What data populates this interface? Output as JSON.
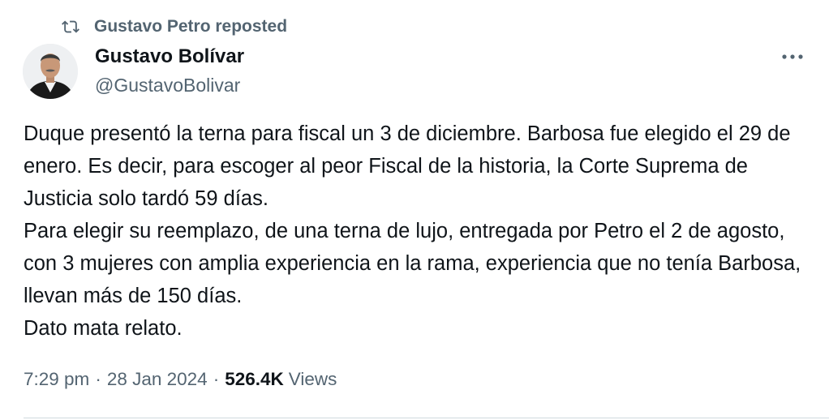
{
  "repost": {
    "label": "Gustavo Petro reposted",
    "icon": "repost-icon"
  },
  "author": {
    "name": "Gustavo Bolívar",
    "handle": "@GustavoBolivar"
  },
  "more": {
    "icon": "more-icon"
  },
  "body": {
    "lines": [
      "Duque presentó la terna para fiscal un 3 de diciembre. Barbosa fue elegido el 29 de enero. Es decir, para escoger al peor Fiscal de la historia, la Corte Suprema de Justicia solo tardó 59 días.",
      "Para elegir su reemplazo, de una terna de lujo, entregada por Petro el 2 de agosto, con 3 mujeres con amplia experiencia en la rama, experiencia que no tenía Barbosa, llevan más de 150 días.",
      "Dato mata relato."
    ]
  },
  "meta": {
    "time": "7:29 pm",
    "date": "28 Jan 2024",
    "separator": "·",
    "views_count": "526.4K",
    "views_label": "Views"
  },
  "colors": {
    "secondary_text": "#536471",
    "primary_text": "#0f1419",
    "divider": "#cfd9de"
  }
}
